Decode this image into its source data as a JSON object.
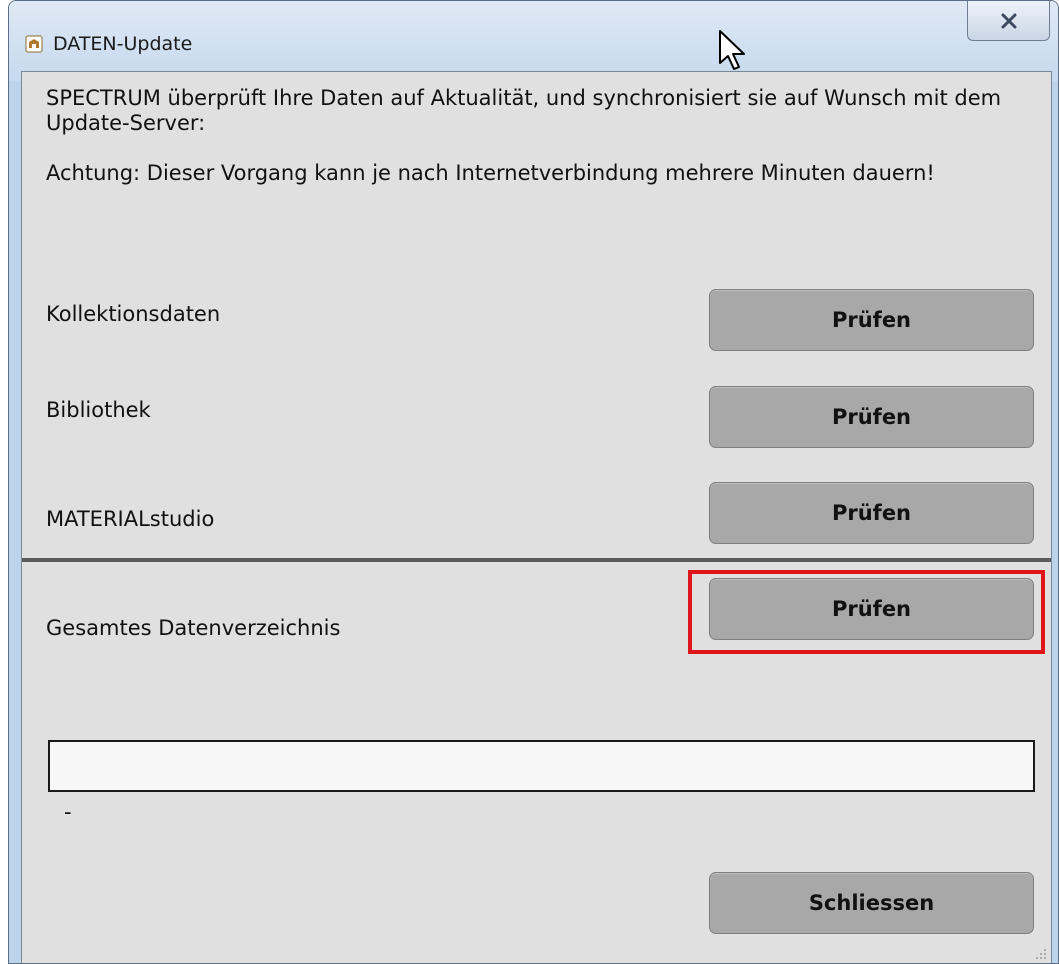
{
  "window": {
    "title": "DATEN-Update",
    "close_icon": "close-x-icon",
    "app_icon": "app-emblem-icon"
  },
  "intro": {
    "line1": "SPECTRUM überprüft Ihre Daten auf Aktualität, und synchronisiert sie auf Wunsch mit dem Update-Server:",
    "line2": "Achtung: Dieser Vorgang kann je nach Internetverbindung mehrere Minuten dauern!"
  },
  "rows": [
    {
      "label": "Kollektionsdaten",
      "button": "Prüfen"
    },
    {
      "label": "Bibliothek",
      "button": "Prüfen"
    },
    {
      "label": "MATERIALstudio",
      "button": "Prüfen"
    },
    {
      "label": "Gesamtes Datenverzeichnis",
      "button": "Prüfen"
    }
  ],
  "progress": {
    "value": 0,
    "status_text": "-"
  },
  "footer": {
    "close_label": "Schliessen"
  },
  "colors": {
    "button_bg": "#a8a8a8",
    "client_bg": "#e0e0e0",
    "highlight": "#e0141b"
  }
}
